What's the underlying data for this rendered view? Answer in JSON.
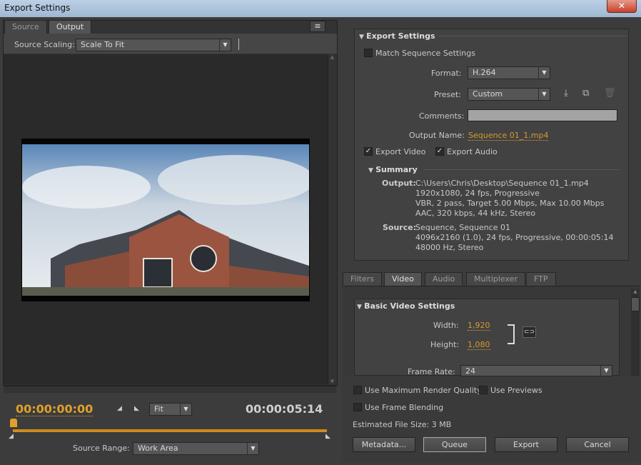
{
  "window": {
    "title": "Export Settings",
    "close": "✕"
  },
  "left": {
    "tabs": [
      "Source",
      "Output"
    ],
    "menu_icon": "≡",
    "source_scaling_label": "Source Scaling:",
    "source_scaling_value": "Scale To Fit",
    "timecode_current": "00:00:00:00",
    "timecode_duration": "00:00:05:14",
    "zoom_value": "Fit",
    "source_range_label": "Source Range:",
    "source_range_value": "Work Area"
  },
  "export_settings": {
    "heading": "Export Settings",
    "match_sequence": "Match Sequence Settings",
    "format_label": "Format:",
    "format_value": "H.264",
    "preset_label": "Preset:",
    "preset_value": "Custom",
    "comments_label": "Comments:",
    "output_name_label": "Output Name:",
    "output_name_value": "Sequence 01_1.mp4",
    "export_video": "Export Video",
    "export_audio": "Export Audio",
    "summary_heading": "Summary",
    "output_label": "Output:",
    "output_lines": [
      "C:\\Users\\Chris\\Desktop\\Sequence 01_1.mp4",
      "1920x1080, 24 fps, Progressive",
      "VBR, 2 pass, Target 5.00 Mbps, Max 10.00 Mbps",
      "AAC, 320 kbps, 44 kHz, Stereo"
    ],
    "source_label": "Source:",
    "source_lines": [
      "Sequence, Sequence 01",
      "4096x2160 (1.0), 24 fps, Progressive, 00:00:05:14",
      "48000 Hz, Stereo"
    ]
  },
  "tabs2": [
    "Filters",
    "Video",
    "Audio",
    "Multiplexer",
    "FTP"
  ],
  "video": {
    "heading": "Basic Video Settings",
    "width_label": "Width:",
    "width_value": "1,920",
    "height_label": "Height:",
    "height_value": "1,080",
    "frame_rate_label": "Frame Rate:",
    "frame_rate_value": "24"
  },
  "bottom": {
    "max_render": "Use Maximum Render Quality",
    "use_previews": "Use Previews",
    "frame_blending": "Use Frame Blending",
    "est_size": "Estimated File Size:  3 MB",
    "buttons": [
      "Metadata...",
      "Queue",
      "Export",
      "Cancel"
    ]
  }
}
